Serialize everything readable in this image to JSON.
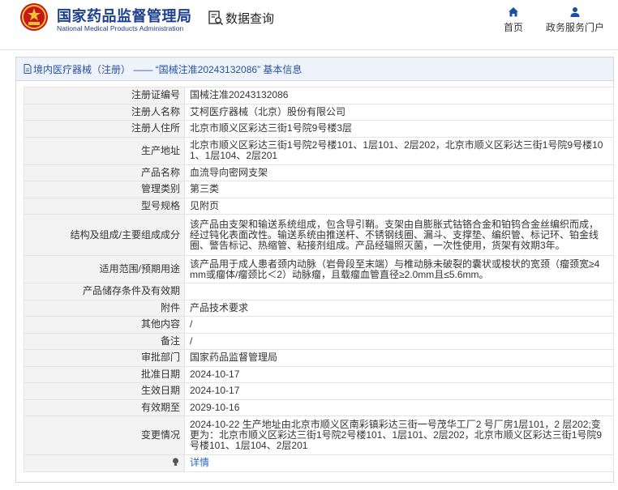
{
  "header": {
    "logo_cn": "国家药品监督管理局",
    "logo_en": "National Medical Products Administration",
    "query_label": "数据查询",
    "nav": [
      {
        "label": "首页",
        "icon": "home-icon"
      },
      {
        "label": "政务服务门户",
        "icon": "user-icon"
      }
    ]
  },
  "panel": {
    "title": "境内医疗器械（注册） —— “国械注准20243132086” 基本信息"
  },
  "rows": [
    {
      "label": "注册证编号",
      "value": "国械注准20243132086"
    },
    {
      "label": "注册人名称",
      "value": "艾柯医疗器械（北京）股份有限公司"
    },
    {
      "label": "注册人住所",
      "value": "北京市顺义区彩达三街1号院9号楼3层"
    },
    {
      "label": "生产地址",
      "value": "北京市顺义区彩达三街1号院2号楼101、1层101、2层202，北京市顺义区彩达三街1号院9号楼101、1层104、2层201"
    },
    {
      "label": "产品名称",
      "value": "血流导向密网支架"
    },
    {
      "label": "管理类别",
      "value": "第三类"
    },
    {
      "label": "型号规格",
      "value": "见附页"
    },
    {
      "label": "结构及组成/主要组成成分",
      "value": "该产品由支架和输送系统组成，包含导引鞘。支架由自膨胀式钴铬合金和铂钨合金丝编织而成，经过钝化表面改性。输送系统由推送杆、不锈钢线圈、漏斗、支撑垫、编织管、标记环、铂金线圈、警告标记、热缩管、粘接剂组成。产品经辐照灭菌，一次性使用，货架有效期3年。"
    },
    {
      "label": "适用范围/预期用途",
      "value": "该产品用于成人患者颈内动脉（岩骨段至末端）与椎动脉未破裂的囊状或梭状的宽颈（瘤颈宽≥4mm或瘤体/瘤颈比＜2）动脉瘤，且载瘤血管直径≥2.0mm且≤5.6mm。"
    },
    {
      "label": "产品储存条件及有效期",
      "value": ""
    },
    {
      "label": "附件",
      "value": "产品技术要求"
    },
    {
      "label": "其他内容",
      "value": "/"
    },
    {
      "label": "备注",
      "value": "/"
    },
    {
      "label": "审批部门",
      "value": "国家药品监督管理局"
    },
    {
      "label": "批准日期",
      "value": "2024-10-17"
    },
    {
      "label": "生效日期",
      "value": "2024-10-17"
    },
    {
      "label": "有效期至",
      "value": "2029-10-16"
    },
    {
      "label": "变更情况",
      "value": "2024-10-22 生产地址由北京市顺义区南彩镇彩达三街一号茂华工厂2 号厂房1层101，2 层202;变更为：北京市顺义区彩达三街1号院2号楼101、1层101、2层202，北京市顺义区彩达三街1号院9号楼101、1层104、2层201"
    }
  ],
  "details_link": "详情"
}
